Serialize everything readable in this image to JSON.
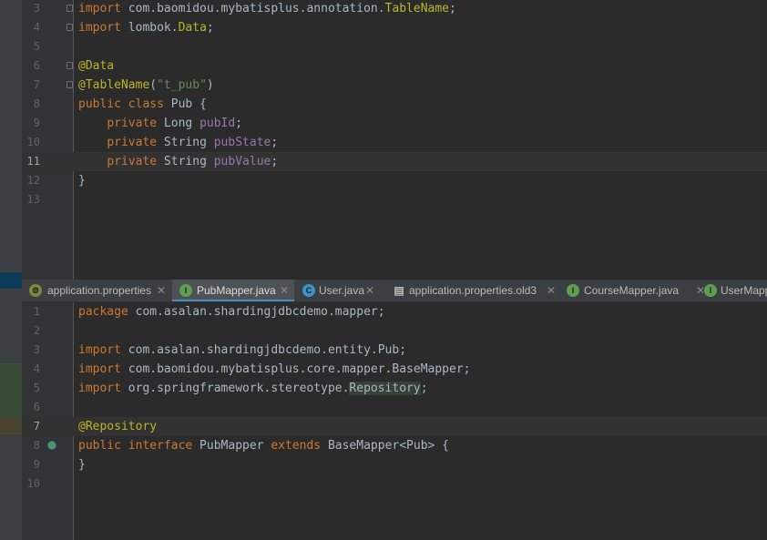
{
  "top_editor": {
    "lines": [
      {
        "num": "3",
        "html": "<span class='k'>import</span> com.baomidou.mybatisplus.annotation.<span class='a'>TableName</span>;"
      },
      {
        "num": "4",
        "html": "<span class='k'>import</span> lombok.<span class='a'>Data</span>;"
      },
      {
        "num": "5",
        "html": ""
      },
      {
        "num": "6",
        "html": "<span class='a'>@Data</span>"
      },
      {
        "num": "7",
        "html": "<span class='a'>@TableName</span>(<span class='s'>\"t_pub\"</span>)"
      },
      {
        "num": "8",
        "html": "<span class='k'>public class</span> Pub {"
      },
      {
        "num": "9",
        "html": "    <span class='k'>private</span> Long <span class='f'>pubId</span>;"
      },
      {
        "num": "10",
        "html": "    <span class='k'>private</span> String <span class='f'>pubState</span>;"
      },
      {
        "num": "11",
        "html": "    <span class='k'>private</span> String <span class='f'>pubValue</span>;"
      },
      {
        "num": "12",
        "html": "}"
      },
      {
        "num": "13",
        "html": ""
      }
    ]
  },
  "tabs": [
    {
      "label": "application.properties",
      "icon": "properties-file-icon",
      "active": false
    },
    {
      "label": "PubMapper.java",
      "icon": "interface-icon",
      "active": true
    },
    {
      "label": "User.java",
      "icon": "class-icon",
      "active": false
    },
    {
      "label": "application.properties.old3",
      "icon": "text-file-icon",
      "active": false
    },
    {
      "label": "CourseMapper.java",
      "icon": "interface-icon",
      "active": false
    },
    {
      "label": "UserMapp",
      "icon": "interface-icon",
      "active": false
    }
  ],
  "bottom_editor": {
    "lines": [
      {
        "num": "1",
        "html": "<span class='k'>package</span> com.asalan.shardingjdbcdemo.mapper;"
      },
      {
        "num": "2",
        "html": ""
      },
      {
        "num": "3",
        "html": "<span class='k'>import</span> com.asalan.shardingjdbcdemo.entity.Pub;"
      },
      {
        "num": "4",
        "html": "<span class='k'>import</span> com.baomidou.mybatisplus.core.mapper.BaseMapper;"
      },
      {
        "num": "5",
        "html": "<span class='k'>import</span> org.springframework.stereotype.<span class='hl'>Repository</span>;"
      },
      {
        "num": "6",
        "html": ""
      },
      {
        "num": "7",
        "html": "<span class='a'>@Repository</span>"
      },
      {
        "num": "8",
        "html": "<span class='k'>public interface</span> PubMapper <span class='k'>extends</span> BaseMapper&lt;Pub&gt; {"
      },
      {
        "num": "9",
        "html": "}"
      },
      {
        "num": "10",
        "html": ""
      }
    ]
  },
  "colors": {
    "keyword": "#cc7832",
    "annotation": "#bbb529",
    "string": "#6a8759",
    "field": "#9876aa",
    "accent": "#4a88c7"
  }
}
